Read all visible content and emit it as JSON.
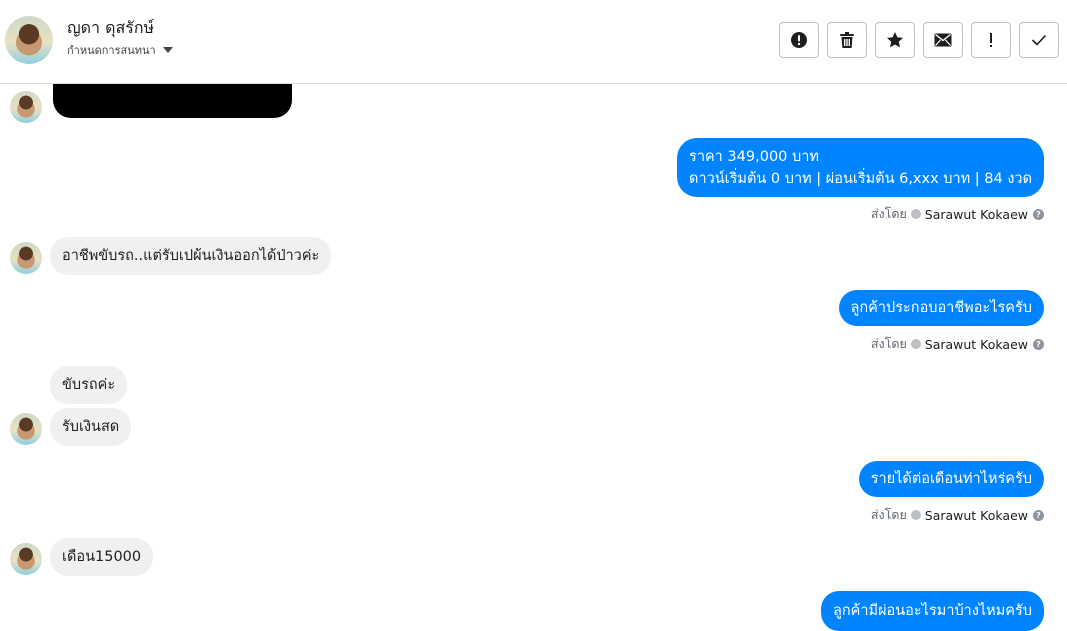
{
  "header": {
    "name": "ญดา ดุสรักษ์",
    "subtitle": "กำหนดการสนทนา",
    "actions": [
      {
        "name": "spam",
        "icon": "alert-circle-icon"
      },
      {
        "name": "delete",
        "icon": "trash-icon"
      },
      {
        "name": "star",
        "icon": "star-icon"
      },
      {
        "name": "mark-unread",
        "icon": "envelope-icon"
      },
      {
        "name": "important",
        "icon": "exclamation-icon"
      },
      {
        "name": "done",
        "icon": "check-icon"
      }
    ]
  },
  "messages": {
    "m1": "ราคา 349,000 บาท",
    "m1_line2": "ดาวน์เริ่มต้น 0 บาท | ผ่อนเริ่มต้น 6,xxx บาท | 84 งวด",
    "m2": "อาชีพขับรถ..แต่รับเปผ้นเงินออกได้ป่าวค่ะ",
    "m3": "ลูกค้าประกอบอาชีพอะไรครับ",
    "m4": "ขับรถค่ะ",
    "m5": "รับเงินสด",
    "m6": "รายได้ต่อเดือนท่าไหร่ครับ",
    "m7": "เดือน15000",
    "m8": "ลูกค้ามีผ่อนอะไรมาบ้างไหมครับ"
  },
  "sent_by": {
    "prefix": "ส่งโดย",
    "sender": "Sarawut Kokaew",
    "help": "?"
  },
  "colors": {
    "outgoing": "#0084ff",
    "incoming": "#f0f0f0",
    "border": "#dddfe2"
  }
}
